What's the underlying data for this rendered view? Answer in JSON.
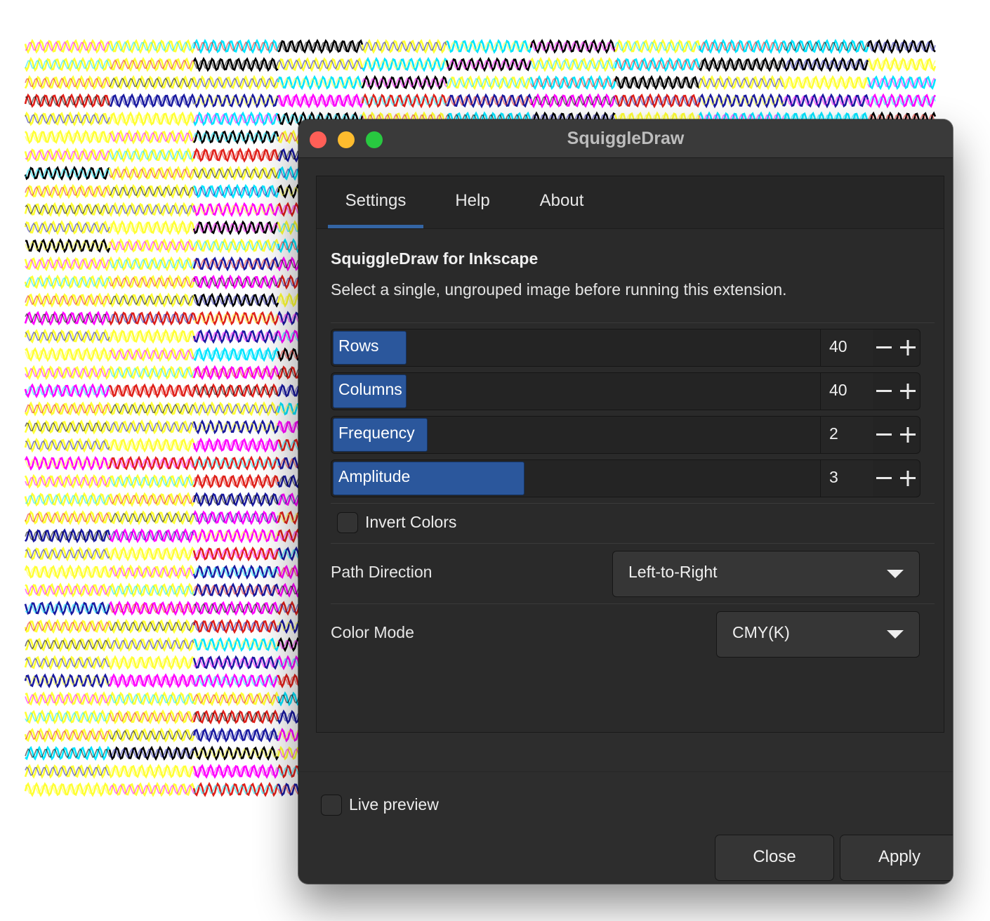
{
  "window": {
    "title": "SquiggleDraw"
  },
  "tabs": [
    {
      "label": "Settings",
      "active": true
    },
    {
      "label": "Help",
      "active": false
    },
    {
      "label": "About",
      "active": false
    }
  ],
  "settings": {
    "heading": "SquiggleDraw for Inkscape",
    "description": "Select a single, ungrouped image before running this extension.",
    "sliders": [
      {
        "label": "Rows",
        "value": "40"
      },
      {
        "label": "Columns",
        "value": "40"
      },
      {
        "label": "Frequency",
        "value": "2"
      },
      {
        "label": "Amplitude",
        "value": "3"
      }
    ],
    "invert_colors": {
      "label": "Invert Colors",
      "checked": false
    },
    "path_direction": {
      "label": "Path Direction",
      "value": "Left-to-Right"
    },
    "color_mode": {
      "label": "Color Mode",
      "value": "CMY(K)"
    }
  },
  "footer": {
    "live_preview": {
      "label": "Live preview",
      "checked": false
    },
    "close_label": "Close",
    "apply_label": "Apply"
  },
  "colors": {
    "accent": "#3465a4",
    "slider_fill": "#2b579c",
    "window_bg": "#2d2d2d",
    "squiggle_palette": [
      "#ffff33",
      "#ff00ff",
      "#00e5ff",
      "#e0201a",
      "#000000",
      "#1a1aa0"
    ]
  }
}
